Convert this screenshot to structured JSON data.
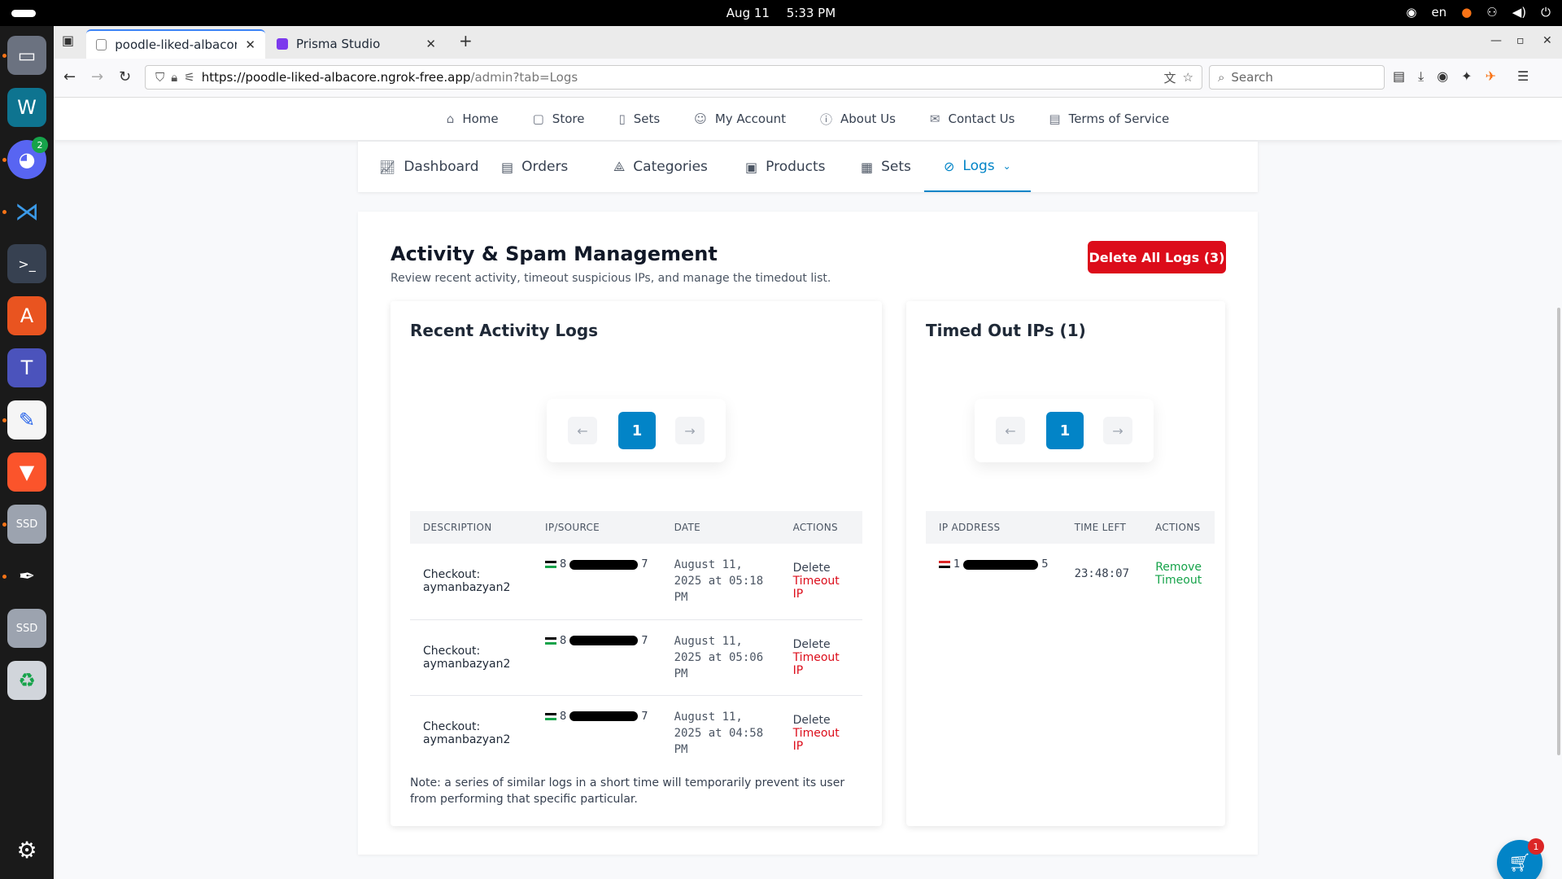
{
  "topbar": {
    "date": "Aug 11",
    "time": "5:33 PM",
    "lang": "en"
  },
  "browser": {
    "tabs": [
      {
        "title": "poodle-liked-albacore.ngrok",
        "active": true
      },
      {
        "title": "Prisma Studio",
        "active": false
      }
    ],
    "url_host": "https://poodle-liked-albacore.ngrok-free.app",
    "url_path": "/admin?tab=Logs",
    "search_placeholder": "Search"
  },
  "site_nav": {
    "items": [
      {
        "label": "Home",
        "icon": "home-icon"
      },
      {
        "label": "Store",
        "icon": "bag-icon"
      },
      {
        "label": "Sets",
        "icon": "book-icon"
      },
      {
        "label": "My Account",
        "icon": "user-icon"
      },
      {
        "label": "About Us",
        "icon": "info-icon"
      },
      {
        "label": "Contact Us",
        "icon": "mail-icon"
      },
      {
        "label": "Terms of Service",
        "icon": "document-icon"
      }
    ]
  },
  "admin_tabs": [
    {
      "label": "Dashboard",
      "icon": "chart-line-icon"
    },
    {
      "label": "Orders",
      "icon": "receipt-icon"
    },
    {
      "label": "Categories",
      "icon": "shapes-icon"
    },
    {
      "label": "Products",
      "icon": "archive-icon"
    },
    {
      "label": "Sets",
      "icon": "grid-icon"
    },
    {
      "label": "Logs",
      "icon": "ban-icon",
      "active": true
    }
  ],
  "main": {
    "title": "Activity & Spam Management",
    "subtitle": "Review recent activity, timeout suspicious IPs, and manage the timedout list.",
    "delete_all_label": "Delete All Logs (3)"
  },
  "logs_card": {
    "title": "Recent Activity Logs",
    "page": "1",
    "prev": "←",
    "next": "→",
    "columns": [
      "DESCRIPTION",
      "IP/SOURCE",
      "DATE",
      "ACTIONS"
    ],
    "rows": [
      {
        "desc1": "Checkout:",
        "desc2": "aymanbazyan2",
        "ip_start": "8",
        "ip_end": "7",
        "date1": "August 11,",
        "date2": "2025 at 05:18",
        "date3": "PM",
        "delete": "Delete",
        "timeout": "Timeout IP"
      },
      {
        "desc1": "Checkout:",
        "desc2": "aymanbazyan2",
        "ip_start": "8",
        "ip_end": "7",
        "date1": "August 11,",
        "date2": "2025 at 05:06",
        "date3": "PM",
        "delete": "Delete",
        "timeout": "Timeout IP"
      },
      {
        "desc1": "Checkout:",
        "desc2": "aymanbazyan2",
        "ip_start": "8",
        "ip_end": "7",
        "date1": "August 11,",
        "date2": "2025 at 04:58",
        "date3": "PM",
        "delete": "Delete",
        "timeout": "Timeout IP"
      }
    ],
    "note": "Note: a series of similar logs in a short time will temporarily prevent its user from performing that specific particular."
  },
  "timeout_card": {
    "title": "Timed Out IPs (1)",
    "page": "1",
    "prev": "←",
    "next": "→",
    "columns": [
      "IP ADDRESS",
      "TIME LEFT",
      "ACTIONS"
    ],
    "rows": [
      {
        "ip_start": "1",
        "ip_end": "5",
        "time_left": "23:48:07",
        "action1": "Remove",
        "action2": "Timeout"
      }
    ]
  },
  "cart": {
    "count": "1"
  },
  "colors": {
    "accent": "#0284c7",
    "danger": "#dc0c1a",
    "success": "#16a34a"
  }
}
